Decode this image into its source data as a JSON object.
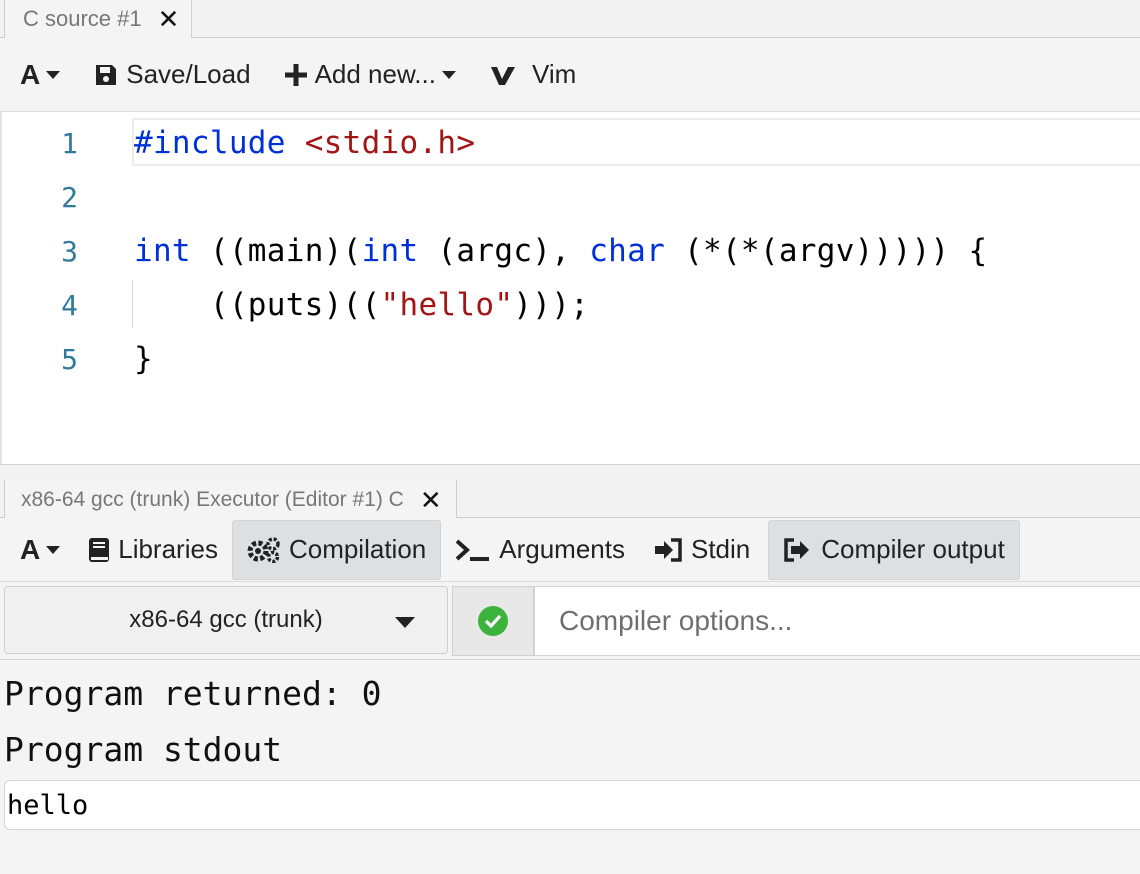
{
  "editor_pane": {
    "tab_title": "C source #1",
    "toolbar": {
      "font_label": "A",
      "save_load_label": "Save/Load",
      "add_new_label": "Add new...",
      "vim_label": "Vim"
    },
    "lines": [
      {
        "number": "1",
        "tokens": [
          {
            "t": "#include",
            "c": "kw"
          },
          {
            "t": " ",
            "c": ""
          },
          {
            "t": "<stdio.h>",
            "c": "str"
          }
        ]
      },
      {
        "number": "2",
        "tokens": []
      },
      {
        "number": "3",
        "tokens": [
          {
            "t": "int",
            "c": "kw"
          },
          {
            "t": " ((main)(",
            "c": ""
          },
          {
            "t": "int",
            "c": "kw"
          },
          {
            "t": " (argc), ",
            "c": ""
          },
          {
            "t": "char",
            "c": "kw"
          },
          {
            "t": " (*(*(argv))))) {",
            "c": ""
          }
        ]
      },
      {
        "number": "4",
        "tokens": [
          {
            "t": "    ((puts)((",
            "c": ""
          },
          {
            "t": "\"hello\"",
            "c": "str"
          },
          {
            "t": ")));",
            "c": ""
          }
        ]
      },
      {
        "number": "5",
        "tokens": [
          {
            "t": "}",
            "c": ""
          }
        ]
      }
    ]
  },
  "executor_pane": {
    "tab_title": "x86-64 gcc (trunk) Executor (Editor #1) C",
    "toolbar": {
      "font_label": "A",
      "libraries_label": "Libraries",
      "compilation_label": "Compilation",
      "arguments_label": "Arguments",
      "stdin_label": "Stdin",
      "compiler_output_label": "Compiler output"
    },
    "compiler": {
      "selected": "x86-64 gcc (trunk)",
      "options_placeholder": "Compiler options...",
      "status": "ok"
    },
    "output": {
      "returned": "Program returned: 0",
      "stdout_heading": "Program stdout",
      "stdout_text": "hello"
    }
  },
  "colors": {
    "keyword": "#0030d8",
    "string": "#a31515",
    "line_number": "#327a9c",
    "status_ok": "#3cb33c"
  }
}
